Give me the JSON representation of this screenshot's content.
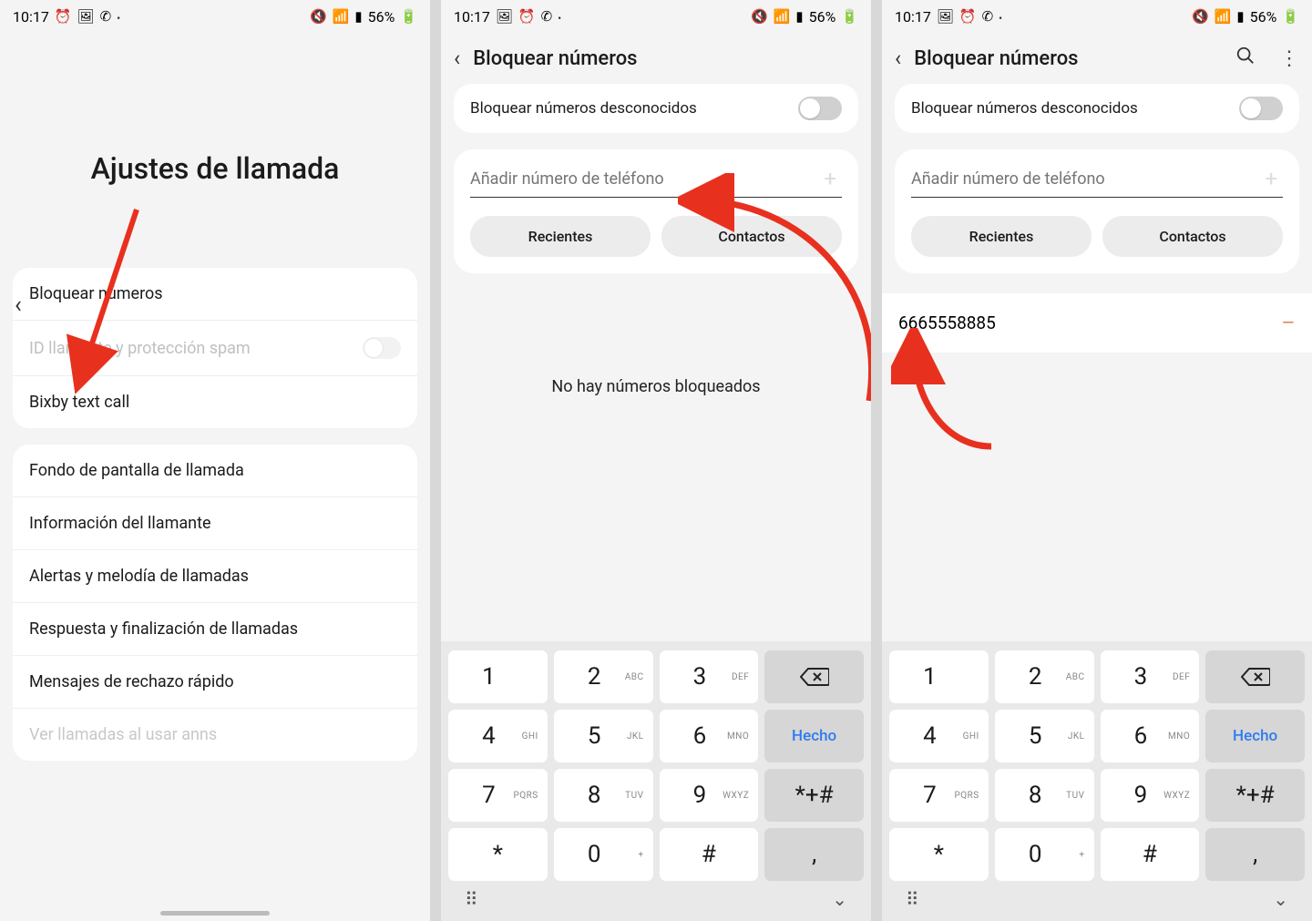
{
  "status": {
    "time": "10:17",
    "battery": "56%"
  },
  "screen1": {
    "title": "Ajustes de llamada",
    "items_a": [
      "Bloquear números",
      "ID llamante y protección spam",
      "Bixby text call"
    ],
    "items_b": [
      "Fondo de pantalla de llamada",
      "Información del llamante",
      "Alertas y melodía de llamadas",
      "Respuesta y finalización de llamadas",
      "Mensajes de rechazo rápido"
    ],
    "cutoff": "Ver llamadas al usar anns"
  },
  "screen2": {
    "title": "Bloquear números",
    "toggle_label": "Bloquear números desconocidos",
    "placeholder": "Añadir número de teléfono",
    "btn_recent": "Recientes",
    "btn_contacts": "Contactos",
    "empty": "No hay números bloqueados"
  },
  "screen3": {
    "title": "Bloquear números",
    "toggle_label": "Bloquear números desconocidos",
    "placeholder": "Añadir número de teléfono",
    "btn_recent": "Recientes",
    "btn_contacts": "Contactos",
    "blocked_number": "6665558885"
  },
  "keypad": {
    "keys": [
      {
        "n": "1",
        "s": ""
      },
      {
        "n": "2",
        "s": "ABC"
      },
      {
        "n": "3",
        "s": "DEF"
      },
      {
        "n": "4",
        "s": "GHI"
      },
      {
        "n": "5",
        "s": "JKL"
      },
      {
        "n": "6",
        "s": "MNO"
      },
      {
        "n": "7",
        "s": "PQRS"
      },
      {
        "n": "8",
        "s": "TUV"
      },
      {
        "n": "9",
        "s": "WXYZ"
      },
      {
        "n": "*",
        "s": ""
      },
      {
        "n": "0",
        "s": "+"
      },
      {
        "n": "#",
        "s": ""
      }
    ],
    "done": "Hecho",
    "sym": "*+#",
    "comma": ","
  }
}
